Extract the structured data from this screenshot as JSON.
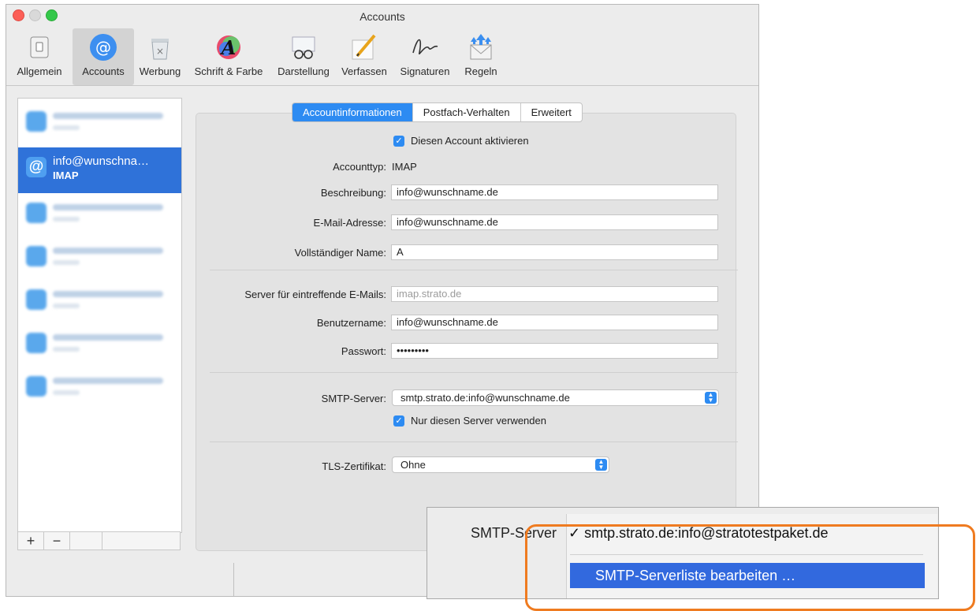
{
  "window": {
    "title": "Accounts"
  },
  "toolbar": {
    "items": [
      {
        "label": "Allgemein",
        "icon": "switch-icon"
      },
      {
        "label": "Accounts",
        "icon": "at-icon"
      },
      {
        "label": "Werbung",
        "icon": "junk-trash-icon"
      },
      {
        "label": "Schrift & Farbe",
        "icon": "font-color-icon"
      },
      {
        "label": "Darstellung",
        "icon": "glasses-icon"
      },
      {
        "label": "Verfassen",
        "icon": "pencil-icon"
      },
      {
        "label": "Signaturen",
        "icon": "signature-icon"
      },
      {
        "label": "Regeln",
        "icon": "rules-envelope-icon"
      }
    ]
  },
  "sidebar": {
    "active_account": {
      "name": "info@wunschna…",
      "type": "IMAP"
    },
    "add_label": "+",
    "remove_label": "−"
  },
  "tabs": [
    "Accountinformationen",
    "Postfach-Verhalten",
    "Erweitert"
  ],
  "form": {
    "enable_label": "Diesen Account aktivieren",
    "accounttype_label": "Accounttyp:",
    "accounttype_value": "IMAP",
    "description_label": "Beschreibung:",
    "description_value": "info@wunschname.de",
    "email_label": "E-Mail-Adresse:",
    "email_value": "info@wunschname.de",
    "fullname_label": "Vollständiger Name:",
    "fullname_value": "A",
    "incoming_label": "Server für eintreffende E-Mails:",
    "incoming_value": "imap.strato.de",
    "username_label": "Benutzername:",
    "username_value": "info@wunschname.de",
    "password_label": "Passwort:",
    "password_value": "•••••••••",
    "smtp_label": "SMTP-Server:",
    "smtp_value": "smtp.strato.de:info@wunschname.de",
    "only_server_label": "Nur diesen Server verwenden",
    "tls_label": "TLS-Zertifikat:",
    "tls_value": "Ohne"
  },
  "overlay": {
    "label": "SMTP-Server",
    "checked_item": "✓  smtp.strato.de:info@stratotestpaket.de",
    "edit_item": "SMTP-Serverliste bearbeiten …"
  },
  "colors": {
    "accent": "#2d8bf2",
    "selection": "#2f72d9",
    "highlight_frame": "#ef7b20"
  }
}
